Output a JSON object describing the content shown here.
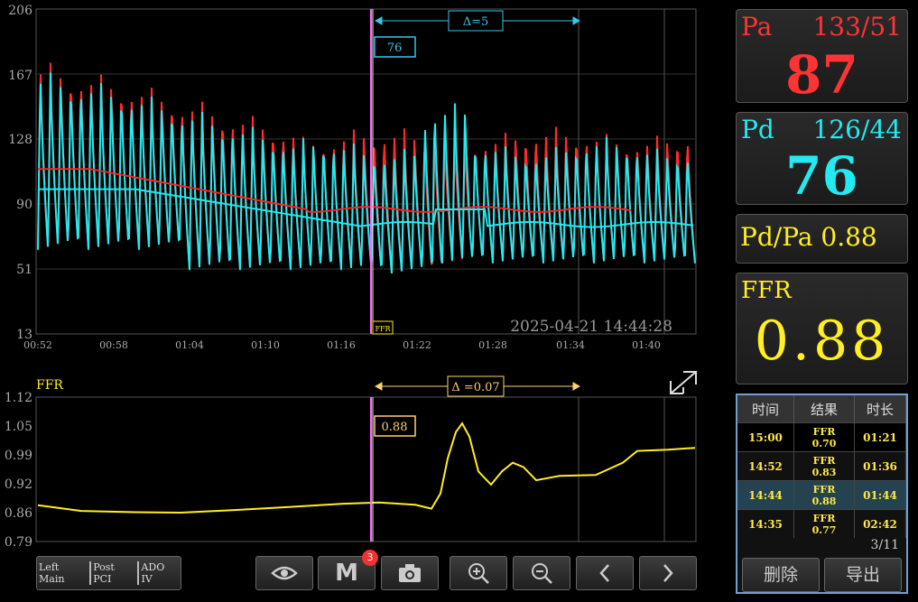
{
  "pressure_chart": {
    "y_ticks": [
      "206",
      "167",
      "128",
      "90",
      "51",
      "13"
    ],
    "x_ticks": [
      "00:52",
      "00:58",
      "01:04",
      "01:10",
      "01:16",
      "01:22",
      "01:28",
      "01:34",
      "01:40"
    ],
    "delta_label": "Δ=5",
    "cursor_value": "76",
    "timestamp": "2025-04-21  14:44:28",
    "ffr_marker": "FFR"
  },
  "ffr_chart": {
    "label": "FFR",
    "y_ticks": [
      "1.12",
      "1.05",
      "0.99",
      "0.92",
      "0.86",
      "0.79"
    ],
    "delta_label": "Δ =0.07",
    "cursor_value": "0.88"
  },
  "panels": {
    "pa": {
      "label": "Pa",
      "range": "133/51",
      "value": "87"
    },
    "pd": {
      "label": "Pd",
      "range": "126/44",
      "value": "76"
    },
    "ratio": {
      "text": "Pd/Pa 0.88"
    },
    "ffr": {
      "label": "FFR",
      "value": "0.88"
    }
  },
  "history": {
    "headers": [
      "时间",
      "结果",
      "时长"
    ],
    "rows": [
      {
        "time": "15:00",
        "res1": "FFR",
        "res2": "0.70",
        "dur": "01:21"
      },
      {
        "time": "14:52",
        "res1": "FFR",
        "res2": "0.83",
        "dur": "01:36"
      },
      {
        "time": "14:44",
        "res1": "FFR",
        "res2": "0.88",
        "dur": "01:44"
      },
      {
        "time": "14:35",
        "res1": "FFR",
        "res2": "0.77",
        "dur": "02:42"
      }
    ],
    "page": "3/11",
    "delete_label": "删除",
    "export_label": "导出"
  },
  "toolbar": {
    "segments": [
      "Left Main",
      "Post PCI",
      "ADO IV"
    ],
    "marker_label": "M",
    "marker_count": "3"
  },
  "colors": {
    "pa": "#ff3333",
    "pd": "#22eaf0",
    "ffr": "#ffee22",
    "cursor": "#ff66ff",
    "delta": "#33c8e8",
    "delta_ffr": "#ffd070"
  }
}
